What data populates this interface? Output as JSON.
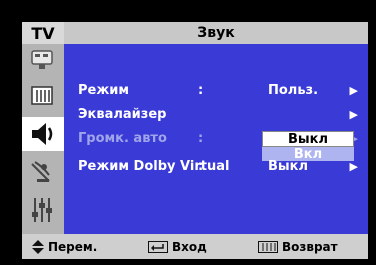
{
  "header": {
    "tv_label": "TV",
    "title": "Звук"
  },
  "sidebar": {
    "items": [
      {
        "icon": "input-icon"
      },
      {
        "icon": "picture-icon"
      },
      {
        "icon": "sound-icon",
        "active": true
      },
      {
        "icon": "channel-icon"
      },
      {
        "icon": "setup-icon"
      }
    ]
  },
  "menu": {
    "rows": [
      {
        "label": "Режим",
        "colon": ":",
        "value": "Польз.",
        "arrow": "▶"
      },
      {
        "label": "Эквалайзер",
        "colon": "",
        "value": "",
        "arrow": "▶"
      },
      {
        "label": "Громк. авто",
        "colon": ":",
        "value": "",
        "arrow": "▶",
        "disabled": true
      },
      {
        "label": "Режим Dolby Virtual",
        "colon": ":",
        "value": "Выкл",
        "arrow": "▶"
      }
    ],
    "dropdown": {
      "selected": "Выкл",
      "other": "Вкл"
    }
  },
  "footer": {
    "move_label": "Перем.",
    "enter_label": "Вход",
    "return_label": "Возврат"
  },
  "colors": {
    "panel": "#3a3ad6",
    "sidebar": "#b4b4b4",
    "footer": "#cfcfcf"
  }
}
